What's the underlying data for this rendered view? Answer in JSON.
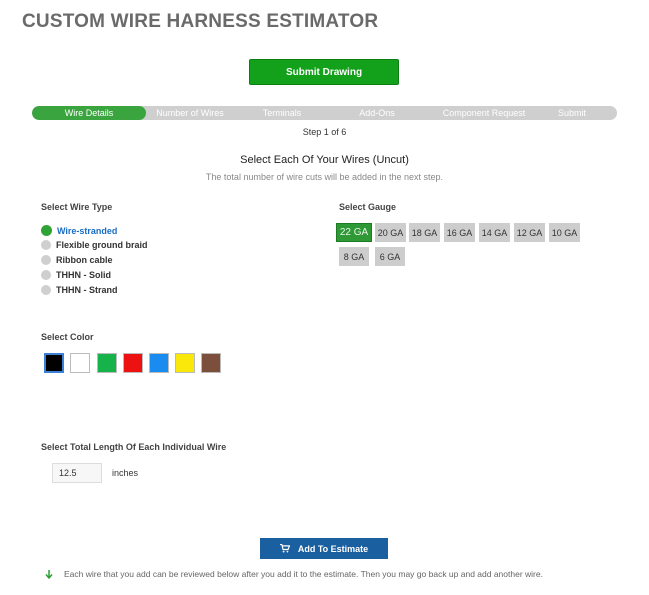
{
  "page": {
    "title": "CUSTOM WIRE HARNESS ESTIMATOR"
  },
  "submit": {
    "label": "Submit Drawing"
  },
  "steps": [
    {
      "label": "Wire Details",
      "active": true
    },
    {
      "label": "Number of Wires"
    },
    {
      "label": "Terminals"
    },
    {
      "label": "Add-Ons"
    },
    {
      "label": "Component Request"
    },
    {
      "label": "Submit"
    }
  ],
  "step_counter": "Step 1 of 6",
  "section": {
    "title": "Select Each Of Your Wires (Uncut)",
    "subtitle": "The total number of wire cuts will be added in the next step."
  },
  "wire_type": {
    "label": "Select Wire Type",
    "options": [
      "Wire-stranded",
      "Flexible ground braid",
      "Ribbon cable",
      "THHN - Solid",
      "THHN - Strand"
    ],
    "selected": "Wire-stranded"
  },
  "gauge": {
    "label": "Select Gauge",
    "options": [
      "22 GA",
      "20 GA",
      "18 GA",
      "16 GA",
      "14 GA",
      "12 GA",
      "10 GA",
      "8 GA",
      "6 GA"
    ],
    "selected": "22 GA"
  },
  "color": {
    "label": "Select Color",
    "swatches": [
      "#000000",
      "#ffffff",
      "#15b34a",
      "#ee1111",
      "#1a8cf0",
      "#fbe80b",
      "#7b4f3c"
    ],
    "selected": "#000000"
  },
  "length": {
    "label": "Select Total Length Of Each Individual Wire",
    "value": "12.5",
    "unit": "inches"
  },
  "add": {
    "label": "Add To Estimate"
  },
  "note": "Each wire that you add can be reviewed below after you add it to the estimate. Then you may go back up and add another wire.",
  "colors": {
    "accent_green": "#13a01a",
    "button_blue": "#1a5fa0",
    "link_blue": "#1a6dc4"
  }
}
